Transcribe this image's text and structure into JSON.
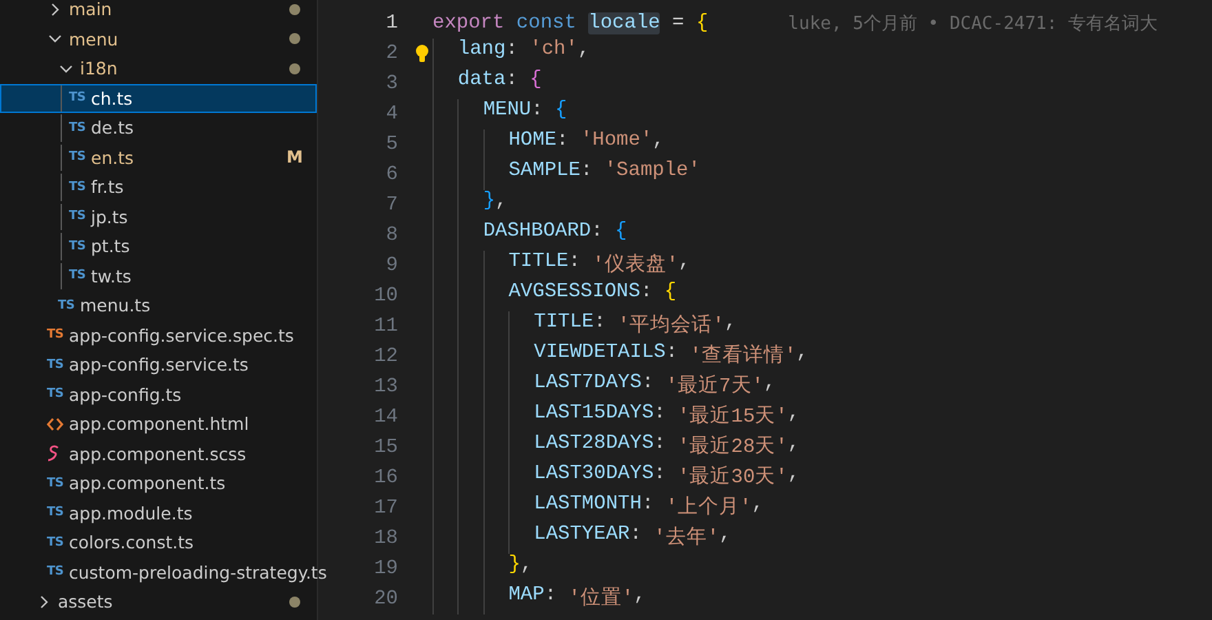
{
  "explorer": {
    "items": [
      {
        "kind": "folder",
        "name": "main",
        "expanded": false,
        "modified": true,
        "has_changes": true
      },
      {
        "kind": "folder",
        "name": "menu",
        "expanded": true,
        "modified": true,
        "has_changes": true,
        "children": [
          {
            "kind": "folder",
            "name": "i18n",
            "expanded": true,
            "modified": true,
            "has_changes": true,
            "children": [
              {
                "kind": "ts",
                "icon_text": "TS",
                "name": "ch.ts",
                "selected": true,
                "modified": false
              },
              {
                "kind": "ts",
                "icon_text": "TS",
                "name": "de.ts",
                "selected": false,
                "modified": false
              },
              {
                "kind": "ts",
                "icon_text": "TS",
                "name": "en.ts",
                "selected": false,
                "modified": true,
                "badge": "M"
              },
              {
                "kind": "ts",
                "icon_text": "TS",
                "name": "fr.ts",
                "selected": false,
                "modified": false
              },
              {
                "kind": "ts",
                "icon_text": "TS",
                "name": "jp.ts",
                "selected": false,
                "modified": false
              },
              {
                "kind": "ts",
                "icon_text": "TS",
                "name": "pt.ts",
                "selected": false,
                "modified": false
              },
              {
                "kind": "ts",
                "icon_text": "TS",
                "name": "tw.ts",
                "selected": false,
                "modified": false
              }
            ]
          },
          {
            "kind": "ts",
            "icon_text": "TS",
            "name": "menu.ts",
            "selected": false,
            "modified": false
          }
        ]
      },
      {
        "kind": "test",
        "icon_text": "TS",
        "name": "app-config.service.spec.ts",
        "selected": false,
        "modified": false
      },
      {
        "kind": "ts",
        "icon_text": "TS",
        "name": "app-config.service.ts",
        "selected": false,
        "modified": false
      },
      {
        "kind": "ts",
        "icon_text": "TS",
        "name": "app-config.ts",
        "selected": false,
        "modified": false
      },
      {
        "kind": "html",
        "name": "app.component.html",
        "selected": false,
        "modified": false
      },
      {
        "kind": "scss",
        "name": "app.component.scss",
        "selected": false,
        "modified": false
      },
      {
        "kind": "ts",
        "icon_text": "TS",
        "name": "app.component.ts",
        "selected": false,
        "modified": false
      },
      {
        "kind": "ts",
        "icon_text": "TS",
        "name": "app.module.ts",
        "selected": false,
        "modified": false
      },
      {
        "kind": "ts",
        "icon_text": "TS",
        "name": "colors.const.ts",
        "selected": false,
        "modified": false
      },
      {
        "kind": "ts",
        "icon_text": "TS",
        "name": "custom-preloading-strategy.ts",
        "selected": false,
        "modified": false
      }
    ],
    "parent_items": [
      {
        "kind": "folder",
        "name": "assets",
        "expanded": false,
        "modified": false,
        "has_changes": true
      }
    ]
  },
  "editor": {
    "lines": [
      {
        "number": "1",
        "current": true,
        "tokens": [
          {
            "kind": "control",
            "text": "export "
          },
          {
            "kind": "keyword",
            "text": "const "
          },
          {
            "kind": "highlight",
            "text": "locale"
          },
          {
            "kind": "plain",
            "text": " = "
          },
          {
            "kind": "bracket1",
            "text": "{"
          }
        ],
        "blame": "luke, 5个月前 • DCAC-2471: 专有名词大"
      },
      {
        "number": "2",
        "current": false,
        "lightbulb": true,
        "tokens": [
          {
            "kind": "property",
            "text": "  lang"
          },
          {
            "kind": "plain",
            "text": ": "
          },
          {
            "kind": "string",
            "text": "'ch'"
          },
          {
            "kind": "plain",
            "text": ","
          }
        ]
      },
      {
        "number": "3",
        "current": false,
        "tokens": [
          {
            "kind": "property",
            "text": "  data"
          },
          {
            "kind": "plain",
            "text": ": "
          },
          {
            "kind": "bracket2",
            "text": "{"
          }
        ]
      },
      {
        "number": "4",
        "current": false,
        "tokens": [
          {
            "kind": "property",
            "text": "    MENU"
          },
          {
            "kind": "plain",
            "text": ": "
          },
          {
            "kind": "bracket3",
            "text": "{"
          }
        ]
      },
      {
        "number": "5",
        "current": false,
        "tokens": [
          {
            "kind": "property",
            "text": "      HOME"
          },
          {
            "kind": "plain",
            "text": ": "
          },
          {
            "kind": "string",
            "text": "'Home'"
          },
          {
            "kind": "plain",
            "text": ","
          }
        ]
      },
      {
        "number": "6",
        "current": false,
        "tokens": [
          {
            "kind": "property",
            "text": "      SAMPLE"
          },
          {
            "kind": "plain",
            "text": ": "
          },
          {
            "kind": "string",
            "text": "'Sample'"
          }
        ]
      },
      {
        "number": "7",
        "current": false,
        "tokens": [
          {
            "kind": "bracket3",
            "text": "    }"
          },
          {
            "kind": "plain",
            "text": ","
          }
        ]
      },
      {
        "number": "8",
        "current": false,
        "tokens": [
          {
            "kind": "property",
            "text": "    DASHBOARD"
          },
          {
            "kind": "plain",
            "text": ": "
          },
          {
            "kind": "bracket3",
            "text": "{"
          }
        ]
      },
      {
        "number": "9",
        "current": false,
        "tokens": [
          {
            "kind": "property",
            "text": "      TITLE"
          },
          {
            "kind": "plain",
            "text": ": "
          },
          {
            "kind": "string",
            "text": "'仪表盘'"
          },
          {
            "kind": "plain",
            "text": ","
          }
        ]
      },
      {
        "number": "10",
        "current": false,
        "tokens": [
          {
            "kind": "property",
            "text": "      AVGSESSIONS"
          },
          {
            "kind": "plain",
            "text": ": "
          },
          {
            "kind": "bracket1",
            "text": "{"
          }
        ]
      },
      {
        "number": "11",
        "current": false,
        "tokens": [
          {
            "kind": "property",
            "text": "        TITLE"
          },
          {
            "kind": "plain",
            "text": ": "
          },
          {
            "kind": "string",
            "text": "'平均会话'"
          },
          {
            "kind": "plain",
            "text": ","
          }
        ]
      },
      {
        "number": "12",
        "current": false,
        "tokens": [
          {
            "kind": "property",
            "text": "        VIEWDETAILS"
          },
          {
            "kind": "plain",
            "text": ": "
          },
          {
            "kind": "string",
            "text": "'查看详情'"
          },
          {
            "kind": "plain",
            "text": ","
          }
        ]
      },
      {
        "number": "13",
        "current": false,
        "tokens": [
          {
            "kind": "property",
            "text": "        LAST7DAYS"
          },
          {
            "kind": "plain",
            "text": ": "
          },
          {
            "kind": "string",
            "text": "'最近7天'"
          },
          {
            "kind": "plain",
            "text": ","
          }
        ]
      },
      {
        "number": "14",
        "current": false,
        "tokens": [
          {
            "kind": "property",
            "text": "        LAST15DAYS"
          },
          {
            "kind": "plain",
            "text": ": "
          },
          {
            "kind": "string",
            "text": "'最近15天'"
          },
          {
            "kind": "plain",
            "text": ","
          }
        ]
      },
      {
        "number": "15",
        "current": false,
        "tokens": [
          {
            "kind": "property",
            "text": "        LAST28DAYS"
          },
          {
            "kind": "plain",
            "text": ": "
          },
          {
            "kind": "string",
            "text": "'最近28天'"
          },
          {
            "kind": "plain",
            "text": ","
          }
        ]
      },
      {
        "number": "16",
        "current": false,
        "tokens": [
          {
            "kind": "property",
            "text": "        LAST30DAYS"
          },
          {
            "kind": "plain",
            "text": ": "
          },
          {
            "kind": "string",
            "text": "'最近30天'"
          },
          {
            "kind": "plain",
            "text": ","
          }
        ]
      },
      {
        "number": "17",
        "current": false,
        "tokens": [
          {
            "kind": "property",
            "text": "        LASTMONTH"
          },
          {
            "kind": "plain",
            "text": ": "
          },
          {
            "kind": "string",
            "text": "'上个月'"
          },
          {
            "kind": "plain",
            "text": ","
          }
        ]
      },
      {
        "number": "18",
        "current": false,
        "tokens": [
          {
            "kind": "property",
            "text": "        LASTYEAR"
          },
          {
            "kind": "plain",
            "text": ": "
          },
          {
            "kind": "string",
            "text": "'去年'"
          },
          {
            "kind": "plain",
            "text": ","
          }
        ]
      },
      {
        "number": "19",
        "current": false,
        "tokens": [
          {
            "kind": "bracket1",
            "text": "      }"
          },
          {
            "kind": "plain",
            "text": ","
          }
        ]
      },
      {
        "number": "20",
        "current": false,
        "tokens": [
          {
            "kind": "property",
            "text": "      MAP"
          },
          {
            "kind": "plain",
            "text": ": "
          },
          {
            "kind": "string",
            "text": "'位置'"
          },
          {
            "kind": "plain",
            "text": ","
          }
        ]
      }
    ]
  }
}
